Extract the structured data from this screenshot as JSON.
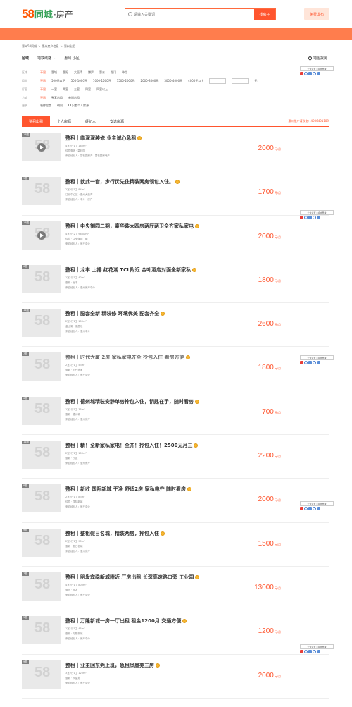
{
  "header": {
    "logo_58": "58",
    "logo_tc": "同城",
    "logo_house": "·房产",
    "search_placeholder": "请输入关键词",
    "search_button": "找房子",
    "post_button": "免费发布"
  },
  "breadcrumb": [
    "惠州58同城",
    "惠州房产信息",
    "惠州出租"
  ],
  "area_tabs": [
    {
      "label": "区域"
    },
    {
      "label": "地铁线路"
    },
    {
      "label": "惠州 小区"
    }
  ],
  "map_find": "地图找房",
  "filters": {
    "region_label": "区域",
    "region_items": [
      "不限",
      "惠城",
      "惠阳",
      "大亚湾",
      "博罗",
      "惠东",
      "龙门",
      "仲恺"
    ],
    "rent_label": "租金",
    "rent_items": [
      "不限",
      "500元以下",
      "500-1000元",
      "1000-1500元",
      "1500-2000元",
      "2000-3000元",
      "3000-4000元",
      "4000元以上"
    ],
    "rent_unit": "元",
    "type_label": "厅室",
    "type_items": [
      "不限",
      "一室",
      "两室",
      "三室",
      "四室",
      "四室以上"
    ],
    "way_label": "方式",
    "way_items": [
      "不限",
      "整套出租",
      "单间出租"
    ],
    "more_label": "更多",
    "more_items": [
      "装修程度",
      "朝向",
      "只看个人房源"
    ]
  },
  "tabs": [
    "整租出租",
    "个人房源",
    "经纪人",
    "安选房源"
  ],
  "promo_text": "惠州推广请致电：4006401189",
  "listings": [
    {
      "count": "13图",
      "title": "整租｜临深深装修 业主诚心急租",
      "meta1": "4室2厅1卫  160m²",
      "meta2": "仲恺惠环 · 碧桂园",
      "meta3": "来自经纪人：碧桂园房产 · 碧桂园房地产",
      "price": "2000",
      "unit": "元/月",
      "video": true,
      "gray": false
    },
    {
      "count": "9图",
      "title": "整租｜就此一套，步行优先住精装两房领包入住。",
      "meta1": "2室2厅1卫  84m²",
      "meta2": "江北中心区 · 惠州大亚湾",
      "meta3": "来自经纪人：中介 · 房产",
      "price": "1700",
      "unit": "元/月",
      "video": false,
      "gray": false
    },
    {
      "count": "13图",
      "title": "整租｜中央御园二期，豪华装大四房两厅两卫全齐家私家电",
      "meta1": "4室2厅2卫  96.00m²",
      "meta2": "仲恺 · 中央御园二期",
      "meta3": "来自经纪人：房产中介",
      "price": "2000",
      "unit": "元/月",
      "video": true,
      "gray": false
    },
    {
      "count": "6图",
      "title": "整租｜龙丰 上排 红花湖 TCL附近 金叶酒店对面全新家私",
      "meta1": "1室1厅1卫  40m²",
      "meta2": "惠城 · 龙丰",
      "meta3": "来自经纪人：惠州房产中介",
      "price": "1800",
      "unit": "元/月",
      "video": false,
      "gray": false
    },
    {
      "count": "11图",
      "title": "整租｜配套全新 精装修 环境优美 配套齐全",
      "meta1": "2室1厅1卫  100m²",
      "meta2": "金山湖 · 雅居乐",
      "meta3": "来自经纪人：惠州中介",
      "price": "2600",
      "unit": "元/月",
      "video": false,
      "gray": false
    },
    {
      "count": "7图",
      "title": "整租｜时代大厦 2房 家私家电齐全 拎包入住 看房方便",
      "meta1": "2室1厅1卫  53m²",
      "meta2": "惠城 · 时代大厦",
      "meta3": "来自经纪人：房产中介",
      "price": "1800",
      "unit": "元/月",
      "video": false,
      "gray": true
    },
    {
      "count": "6图",
      "title": "整租｜德州城精装安静单房拎包入住，钥匙在手，随时看房",
      "meta1": "1室1厅1卫  35m²",
      "meta2": "惠城 · 德州城",
      "meta3": "来自经纪人：惠州房产",
      "price": "700",
      "unit": "元/月",
      "video": false,
      "gray": false
    },
    {
      "count": "11图",
      "title": "整租｜精！全新家私家电！全齐！拎包入住！2500元月三",
      "meta1": "2室2厅1卫  100m²",
      "meta2": "惠城 · 小区",
      "meta3": "来自经纪人：惠州房产",
      "price": "2200",
      "unit": "元/月",
      "video": false,
      "gray": false
    },
    {
      "count": "8图",
      "title": "整租｜新收 国际新城 干净 舒适2房 家私电齐 随时看房",
      "meta1": "2室2厅1卫  83m²",
      "meta2": "仲恺 · 国际新城",
      "meta3": "来自经纪人：房产中介",
      "price": "2000",
      "unit": "元/月",
      "video": false,
      "gray": false
    },
    {
      "count": "9图",
      "title": "整租｜整租假日名城，精装两房，拎包入住",
      "meta1": "2室1厅1卫  90m²",
      "meta2": "惠城 · 假日名城",
      "meta3": "来自经纪人：惠州房产",
      "price": "1500",
      "unit": "元/月",
      "video": false,
      "gray": false
    },
    {
      "count": "7图",
      "title": "整租｜明发宾稳新城附近 厂房出租 长深高速路口旁 工业园",
      "meta1": "4室2厅1卫  800m²",
      "meta2": "惠阳 · 明发",
      "meta3": "来自经纪人：房产中介",
      "price": "13000",
      "unit": "元/月",
      "video": false,
      "gray": false
    },
    {
      "count": "5图",
      "title": "整租｜万隆新城一房一厅出租 租金1200月 交通方便",
      "meta1": "1室1厅1卫  45m²",
      "meta2": "惠城 · 万隆新城",
      "meta3": "来自经纪人：房产中介",
      "price": "1200",
      "unit": "元/月",
      "video": false,
      "gray": false
    },
    {
      "count": "9图",
      "title": "整租｜业主回东莞上班，急租凤凰苑三房",
      "meta1": "3室2厅1卫  120m²",
      "meta2": "惠城 · 凤凰苑",
      "meta3": "来自经纪人：房产中介",
      "price": "2000",
      "unit": "元/月",
      "video": false,
      "gray": false
    }
  ],
  "widget_label": "个性设置 | 点这里看"
}
